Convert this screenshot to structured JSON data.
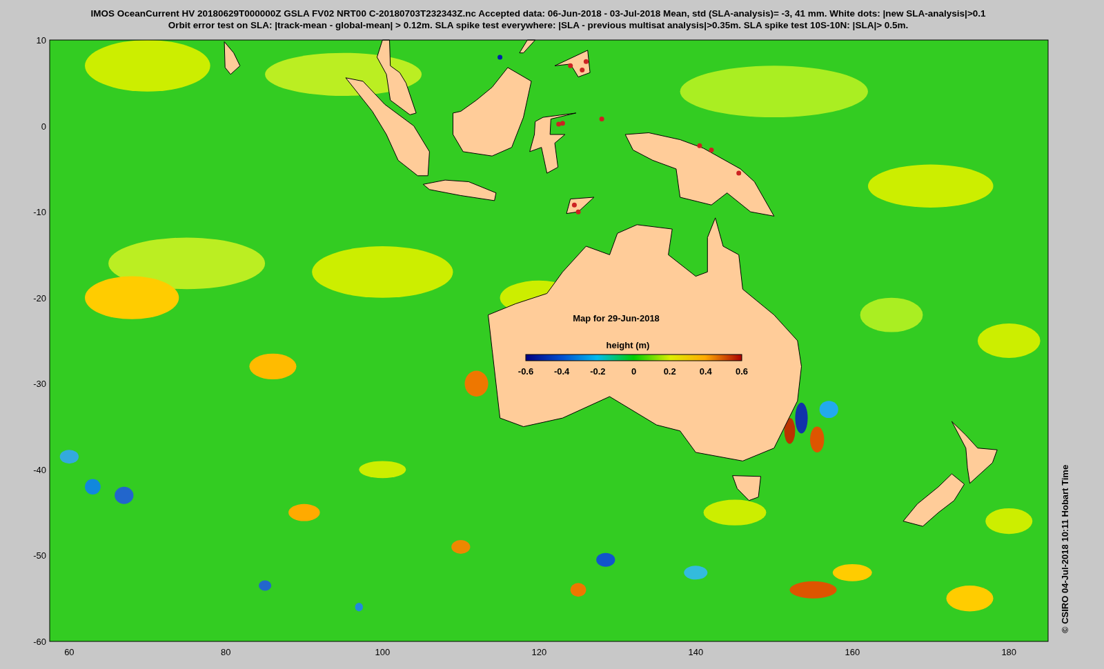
{
  "title_lines": [
    "IMOS OceanCurrent HV 20180629T000000Z GSLA FV02 NRT00 C-20180703T232343Z.nc  Accepted data: 06-Jun-2018 - 03-Jul-2018 Mean, std (SLA-analysis)= -3, 41 mm. White dots: |new SLA-analysis|>0.1",
    "Orbit error test on SLA: |track-mean  - global-mean| > 0.12m.  SLA spike test everywhere: |SLA - previous multisat analysis|>0.35m. SLA spike test 10S-10N: |SLA|> 0.5m."
  ],
  "map": {
    "date_label": "Map for 29-Jun-2018",
    "colorbar": {
      "title": "height (m)",
      "tick_labels": [
        "-0.6",
        "-0.4",
        "-0.2",
        "0",
        "0.2",
        "0.4",
        "0.6"
      ]
    }
  },
  "x_axis": {
    "tick_labels": [
      "60",
      "80",
      "100",
      "120",
      "140",
      "160",
      "180"
    ]
  },
  "y_axis": {
    "tick_labels": [
      "10",
      "0",
      "-10",
      "-20",
      "-30",
      "-40",
      "-50",
      "-60"
    ]
  },
  "credit": "© CSIRO 04-Jul-2018 10:11 Hobart Time"
}
